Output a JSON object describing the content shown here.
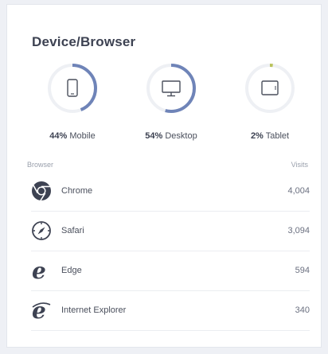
{
  "card": {
    "title": "Device/Browser"
  },
  "devices": [
    {
      "pct": "44%",
      "label": "Mobile",
      "value": 0.44,
      "icon": "mobile-icon"
    },
    {
      "pct": "54%",
      "label": "Desktop",
      "value": 0.54,
      "icon": "desktop-icon"
    },
    {
      "pct": "2%",
      "label": "Tablet",
      "value": 0.02,
      "icon": "tablet-icon"
    }
  ],
  "table": {
    "header_browser": "Browser",
    "header_visits": "Visits",
    "rows": [
      {
        "name": "Chrome",
        "visits": "4,004",
        "icon": "chrome-icon"
      },
      {
        "name": "Safari",
        "visits": "3,094",
        "icon": "safari-icon"
      },
      {
        "name": "Edge",
        "visits": "594",
        "icon": "edge-icon"
      },
      {
        "name": "Internet Explorer",
        "visits": "340",
        "icon": "internet-explorer-icon"
      }
    ]
  },
  "colors": {
    "accent": "#6f84b8",
    "track": "#eef0f4",
    "text": "#3d4252",
    "muted": "#9aa0ac"
  }
}
